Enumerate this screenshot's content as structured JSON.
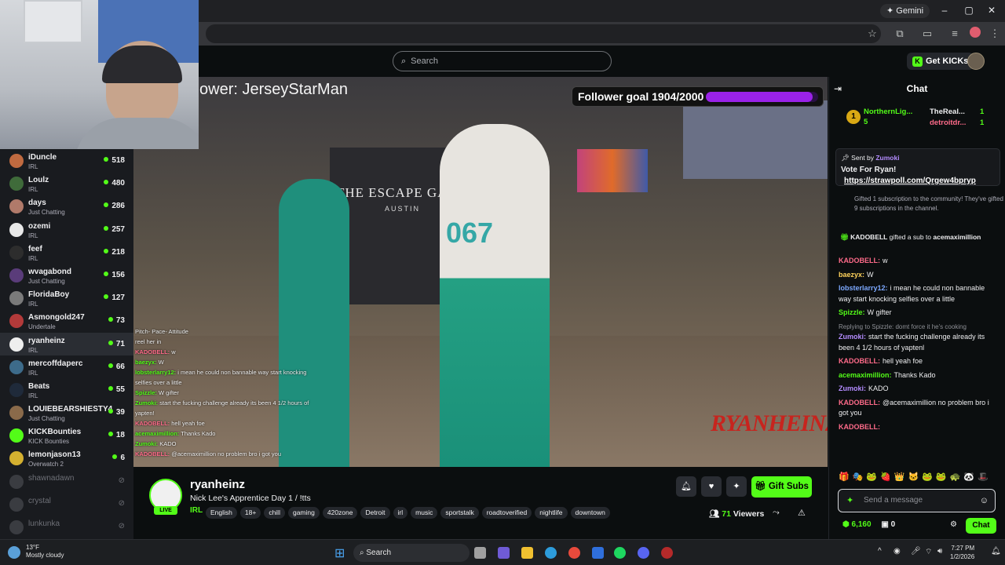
{
  "browser": {
    "gemini_label": "Gemini",
    "window_controls": [
      "–",
      "▢",
      "✕"
    ]
  },
  "kick_header": {
    "search_placeholder": "Search",
    "get_kicks_label": "Get KICKs"
  },
  "sidebar": {
    "channels": [
      {
        "name": "iDuncle",
        "category": "IRL",
        "viewers": "518",
        "color": "#c06a40"
      },
      {
        "name": "Loulz",
        "category": "IRL",
        "viewers": "480",
        "color": "#3f6b3a"
      },
      {
        "name": "days",
        "category": "Just Chatting",
        "viewers": "286",
        "color": "#b07a6a"
      },
      {
        "name": "ozemi",
        "category": "IRL",
        "viewers": "257",
        "color": "#e8e8e8"
      },
      {
        "name": "feef",
        "category": "IRL",
        "viewers": "218",
        "color": "#2d2d2d"
      },
      {
        "name": "wvagabond",
        "category": "Just Chatting",
        "viewers": "156",
        "color": "#5a3c7a"
      },
      {
        "name": "FloridaBoy",
        "category": "IRL",
        "viewers": "127",
        "color": "#7a7a7a"
      },
      {
        "name": "Asmongold247",
        "category": "Undertale",
        "viewers": "73",
        "color": "#b33a3a"
      },
      {
        "name": "ryanheinz",
        "category": "IRL",
        "viewers": "71",
        "color": "#eeeeee"
      },
      {
        "name": "mercoffdaperc",
        "category": "IRL",
        "viewers": "66",
        "color": "#3d6b8a"
      },
      {
        "name": "Beats",
        "category": "IRL",
        "viewers": "55",
        "color": "#1f2a3a"
      },
      {
        "name": "LOUIEBEARSHIESTY4",
        "category": "Just Chatting",
        "viewers": "39",
        "color": "#8a6a4a"
      },
      {
        "name": "KICKBounties",
        "category": "KICK Bounties",
        "viewers": "18",
        "color": "#53fc18"
      },
      {
        "name": "lemonjason13",
        "category": "Overwatch 2",
        "viewers": "6",
        "color": "#d4b030"
      }
    ],
    "offline": [
      "shawnadawn",
      "crystal",
      "lunkunka"
    ]
  },
  "video": {
    "overlay_text": "ower: JerseyStarMan",
    "follower_goal_label": "Follower goal 1904/2000",
    "goal_current": 1904,
    "goal_target": 2000,
    "watermark": "RYANHEINZ",
    "scene_sign_top": "THE ESCAPE GAME",
    "scene_sign_bottom": "AUSTIN",
    "shirt_number": "067",
    "overlay_chat": [
      {
        "user": "",
        "text": "Pitch- Pace- Attitude"
      },
      {
        "user": "",
        "text": "reel her in"
      },
      {
        "user": "KADOBELL:",
        "text": "w"
      },
      {
        "user": "baezyx:",
        "text": "W"
      },
      {
        "user": "lobsterlarry12:",
        "text": "i mean he could non bannable way start knocking selfies over a little"
      },
      {
        "user": "Spizzle:",
        "text": "W gifter"
      },
      {
        "user": "Zumoki:",
        "text": "start the fucking challenge already its been 4 1/2 hours of yapten!"
      },
      {
        "user": "KADOBELL:",
        "text": "hell yeah foe"
      },
      {
        "user": "acemaximillion:",
        "text": "Thanks Kado"
      },
      {
        "user": "Zumoki:",
        "text": "KADO"
      },
      {
        "user": "KADOBELL:",
        "text": "@acemaximillion no problem bro i got you"
      }
    ]
  },
  "stream": {
    "live_badge": "LIVE",
    "username": "ryanheinz",
    "title": "Nick Lee's Apprentice Day 1 / !tts",
    "category": "IRL",
    "tags": [
      "English",
      "18+",
      "chill",
      "gaming",
      "420zone",
      "Detroit",
      "irl",
      "music",
      "sportstalk",
      "roadtoverified",
      "nightlife",
      "downtown"
    ],
    "gift_subs_label": "Gift Subs",
    "viewers_count": "71",
    "viewers_label": "Viewers"
  },
  "chat": {
    "header": "Chat",
    "leaderboard": [
      {
        "rank": "1",
        "name": "NorthernLig...",
        "count": "5"
      },
      {
        "name": "TheReal...",
        "count": "1"
      },
      {
        "name": "detroitdr...",
        "count": "1"
      }
    ],
    "pinned": {
      "sent_by_label": "Sent by",
      "sent_by_user": "Zumoki",
      "title": "Vote For Ryan!",
      "link": "https://strawpoll.com/Qrgew4bpryp"
    },
    "gift_info": "Gifted 1 subscription to the community! They've gifted 9 subscriptions in the channel.",
    "gift_event_user": "KADOBELL",
    "gift_event_text": "gifted a sub to",
    "gift_event_target": "acemaximillion",
    "messages": [
      {
        "user": "KADOBELL:",
        "color": "#ff6b8a",
        "text": "w",
        "reply": ""
      },
      {
        "user": "baezyx:",
        "color": "#ffd35c",
        "text": "W",
        "reply": ""
      },
      {
        "user": "lobsterlarry12:",
        "color": "#7da9ff",
        "text": "i mean he could non bannable way start knocking selfies over a little",
        "reply": ""
      },
      {
        "user": "Spizzle:",
        "color": "#53fc18",
        "text": "W gifter",
        "reply": ""
      },
      {
        "user": "Zumoki:",
        "color": "#b48cff",
        "text": "start the fucking challenge already its been 4 1/2 hours of yaptenl",
        "reply": "Replying to Spizzle: domt force it he's cooking"
      },
      {
        "user": "KADOBELL:",
        "color": "#ff6b8a",
        "text": "hell yeah foe",
        "reply": ""
      },
      {
        "user": "acemaximillion:",
        "color": "#53fc18",
        "text": "Thanks Kado",
        "reply": ""
      },
      {
        "user": "Zumoki:",
        "color": "#b48cff",
        "text": "KADO",
        "reply": ""
      },
      {
        "user": "KADOBELL:",
        "color": "#ff6b8a",
        "text": "@acemaximillion no problem bro i got you",
        "reply": ""
      },
      {
        "user": "KADOBELL:",
        "color": "#ff6b8a",
        "text": "",
        "reply": ""
      }
    ],
    "input_placeholder": "Send a message",
    "kicks_balance": "6,160",
    "points": "0",
    "send_label": "Chat"
  },
  "taskbar": {
    "weather_temp": "13°F",
    "weather_desc": "Mostly cloudy",
    "search_label": "Search",
    "time": "7:27 PM",
    "date": "1/2/2026"
  }
}
